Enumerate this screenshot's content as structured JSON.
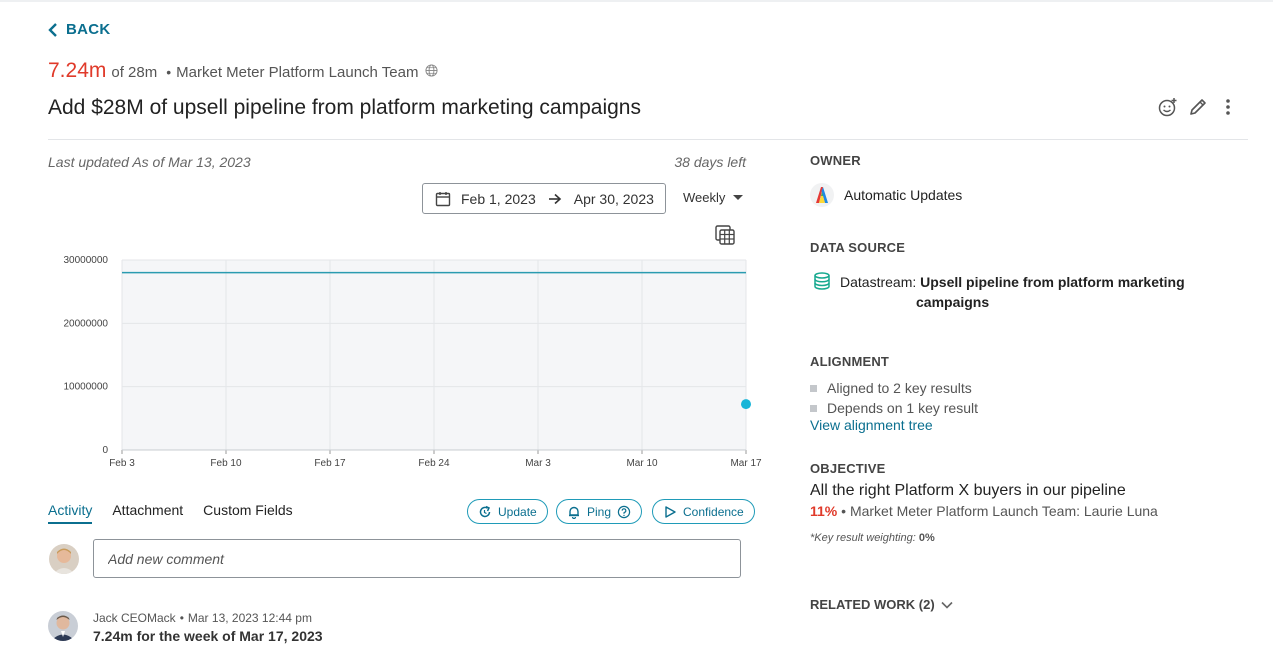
{
  "nav": {
    "back_label": "BACK"
  },
  "header": {
    "current_value": "7.24m",
    "target_text": "of 28m",
    "separator": "•",
    "team": "Market Meter Platform Launch Team",
    "title": "Add $28M of upsell pipeline from platform marketing campaigns",
    "action_icons": [
      "emoji-add-icon",
      "pencil-icon",
      "more-vertical-icon"
    ]
  },
  "meta": {
    "last_updated": "Last updated As of Mar 13, 2023",
    "days_left": "38 days left"
  },
  "controls": {
    "start_date": "Feb 1, 2023",
    "end_date": "Apr 30, 2023",
    "period": "Weekly"
  },
  "chart_data": {
    "type": "line",
    "x_ticks": [
      "Feb 3",
      "Feb 10",
      "Feb 17",
      "Feb 24",
      "Mar 3",
      "Mar 10",
      "Mar 17"
    ],
    "y_ticks": [
      "0",
      "10000000",
      "20000000",
      "30000000"
    ],
    "ylim": [
      0,
      30000000
    ],
    "series": [
      {
        "kind": "target-line",
        "color": "#2a9bb0",
        "values": [
          28000000,
          28000000,
          28000000,
          28000000,
          28000000,
          28000000,
          28000000
        ]
      },
      {
        "kind": "point",
        "color": "#17b5d8",
        "points": [
          {
            "x": "Mar 17",
            "y": 7240000
          }
        ]
      }
    ],
    "grid": true,
    "plot_background": "#f5f6f8"
  },
  "activity": {
    "tabs": [
      {
        "label": "Activity",
        "active": true
      },
      {
        "label": "Attachment",
        "active": false
      },
      {
        "label": "Custom Fields",
        "active": false
      }
    ],
    "buttons": {
      "update": "Update",
      "ping": "Ping",
      "confidence": "Confidence"
    },
    "comment_placeholder": "Add new comment",
    "entries": [
      {
        "author": "Jack CEOMack",
        "separator": "•",
        "timestamp": "Mar 13, 2023 12:44 pm",
        "text": "7.24m for the week of Mar 17, 2023"
      }
    ]
  },
  "sidebar": {
    "owner": {
      "label": "OWNER",
      "name": "Automatic Updates"
    },
    "data_source": {
      "label": "DATA SOURCE",
      "prefix": "Datastream:",
      "name_line1": "Upsell pipeline from platform marketing",
      "name_line2": "campaigns"
    },
    "alignment": {
      "label": "ALIGNMENT",
      "items": [
        "Aligned to 2 key results",
        "Depends on 1 key result"
      ],
      "link": "View alignment tree"
    },
    "objective": {
      "label": "OBJECTIVE",
      "title": "All the right Platform X buyers in our pipeline",
      "percent": "11%",
      "separator": "•",
      "team_owner": "Market Meter Platform Launch Team: Laurie Luna",
      "weighting_label": "*Key result weighting:",
      "weighting_value": "0%"
    },
    "related_work": {
      "label": "RELATED WORK (2)"
    }
  },
  "colors": {
    "accent": "#0b6f8f",
    "progress_red": "#e03a2a",
    "chart_line": "#2a9bb0",
    "chart_point": "#17b5d8"
  }
}
